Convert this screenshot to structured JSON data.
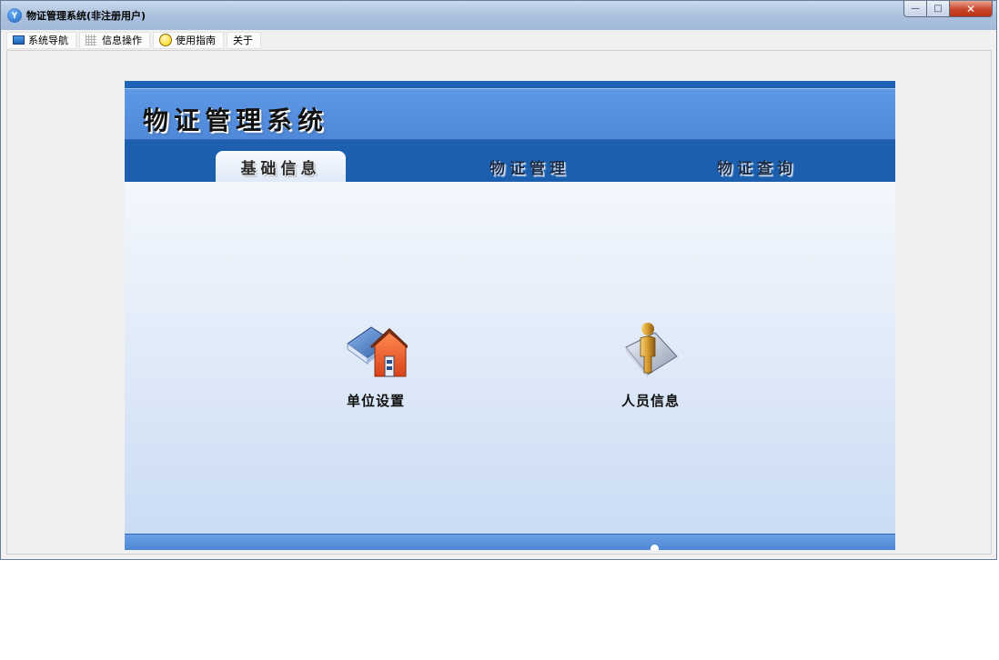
{
  "window": {
    "title": "物证管理系统(非注册用户)",
    "controls": {
      "minimize": "—",
      "maximize": "□",
      "close": "✕"
    }
  },
  "menu": {
    "items": [
      {
        "label": "系统导航",
        "icon": "monitor-icon"
      },
      {
        "label": "信息操作",
        "icon": "grid-icon"
      },
      {
        "label": "使用指南",
        "icon": "bulb-icon"
      },
      {
        "label": "关于",
        "icon": ""
      }
    ]
  },
  "panel": {
    "title": "物证管理系统",
    "tabs": [
      {
        "label": "基础信息",
        "active": true
      },
      {
        "label": "物证管理",
        "active": false
      },
      {
        "label": "物证查询",
        "active": false
      }
    ],
    "features": [
      {
        "label": "单位设置",
        "icon": "unit-settings-icon"
      },
      {
        "label": "人员信息",
        "icon": "person-info-icon"
      }
    ]
  },
  "colors": {
    "title_bar": "#a9bfdc",
    "header_blue": "#5591e0",
    "tab_bar_blue": "#1b5fae",
    "close_red": "#c9462b"
  }
}
